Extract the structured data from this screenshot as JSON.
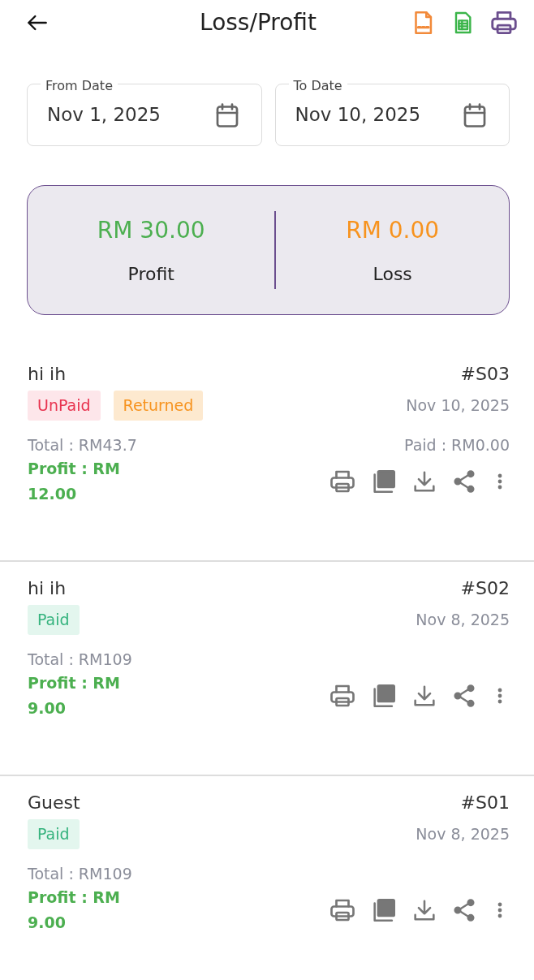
{
  "header": {
    "title": "Loss/Profit"
  },
  "date_fields": [
    {
      "label": "From Date",
      "value": "Nov 1, 2025"
    },
    {
      "label": "To Date",
      "value": "Nov 10, 2025"
    }
  ],
  "summary": [
    {
      "kind": "profit",
      "amount": "RM 30.00",
      "label": "Profit"
    },
    {
      "kind": "loss",
      "amount": "RM 0.00",
      "label": "Loss"
    }
  ],
  "records": [
    {
      "customer": "hi ih",
      "number": "#S03",
      "tags": [
        {
          "kind": "unpaid",
          "text": "UnPaid"
        },
        {
          "kind": "returned",
          "text": "Returned"
        }
      ],
      "date": "Nov 10, 2025",
      "total": "Total : RM43.7",
      "paid": "Paid : RM0.00",
      "profit": "Profit : RM 12.00"
    },
    {
      "customer": "hi ih",
      "number": "#S02",
      "tags": [
        {
          "kind": "paid",
          "text": "Paid"
        }
      ],
      "date": "Nov 8, 2025",
      "total": "Total : RM109",
      "profit": "Profit : RM 9.00"
    },
    {
      "customer": "Guest",
      "number": "#S01",
      "tags": [
        {
          "kind": "paid",
          "text": "Paid"
        }
      ],
      "date": "Nov 8, 2025",
      "total": "Total : RM109",
      "profit": "Profit : RM 9.00"
    }
  ]
}
